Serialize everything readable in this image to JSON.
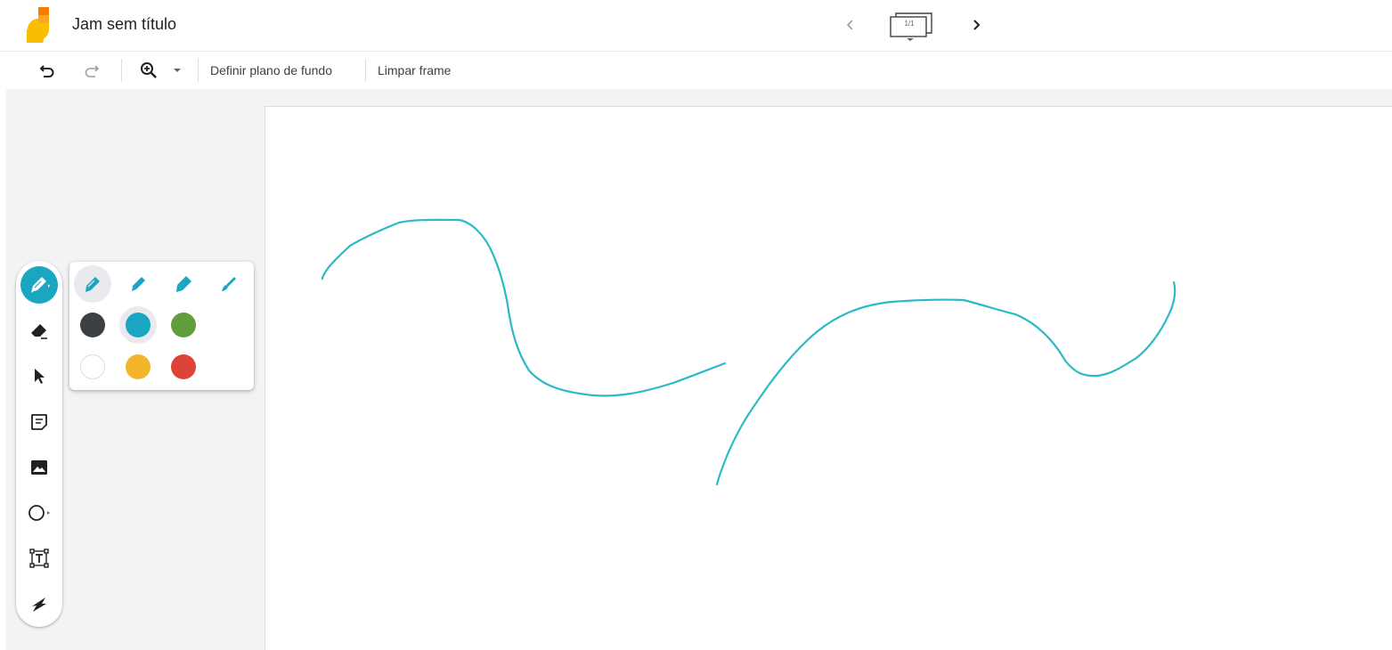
{
  "header": {
    "title": "Jam sem título",
    "frame_counter": "1/1",
    "logo_colors": {
      "orange": "#f57c00",
      "yellow": "#fbbc04"
    }
  },
  "toolbar": {
    "set_background_label": "Definir plano de fundo",
    "clear_frame_label": "Limpar frame"
  },
  "tools": [
    {
      "name": "pen-tool",
      "icon": "marker-icon",
      "active": true
    },
    {
      "name": "eraser-tool",
      "icon": "eraser-icon",
      "active": false
    },
    {
      "name": "select-tool",
      "icon": "cursor-arrow-icon",
      "active": false
    },
    {
      "name": "sticky-note-tool",
      "icon": "sticky-note-icon",
      "active": false
    },
    {
      "name": "image-tool",
      "icon": "image-icon",
      "active": false
    },
    {
      "name": "shape-tool",
      "icon": "circle-icon",
      "active": false
    },
    {
      "name": "text-box-tool",
      "icon": "text-box-icon",
      "active": false
    },
    {
      "name": "laser-tool",
      "icon": "laser-icon",
      "active": false
    }
  ],
  "pen_types": [
    {
      "name": "pen",
      "selected": true
    },
    {
      "name": "marker",
      "selected": false
    },
    {
      "name": "highlighter",
      "selected": false
    },
    {
      "name": "brush",
      "selected": false
    }
  ],
  "pen_colors": [
    {
      "name": "black",
      "hex": "#3c4043",
      "selected": false
    },
    {
      "name": "blue",
      "hex": "#1aa6c1",
      "selected": true
    },
    {
      "name": "green",
      "hex": "#5f9e3a",
      "selected": false
    },
    {
      "name": "white",
      "hex": "#ffffff",
      "selected": false
    },
    {
      "name": "yellow",
      "hex": "#f4b42c",
      "selected": false
    },
    {
      "name": "red",
      "hex": "#db4437",
      "selected": false
    }
  ],
  "canvas": {
    "stroke_color": "#2bb9c6"
  }
}
